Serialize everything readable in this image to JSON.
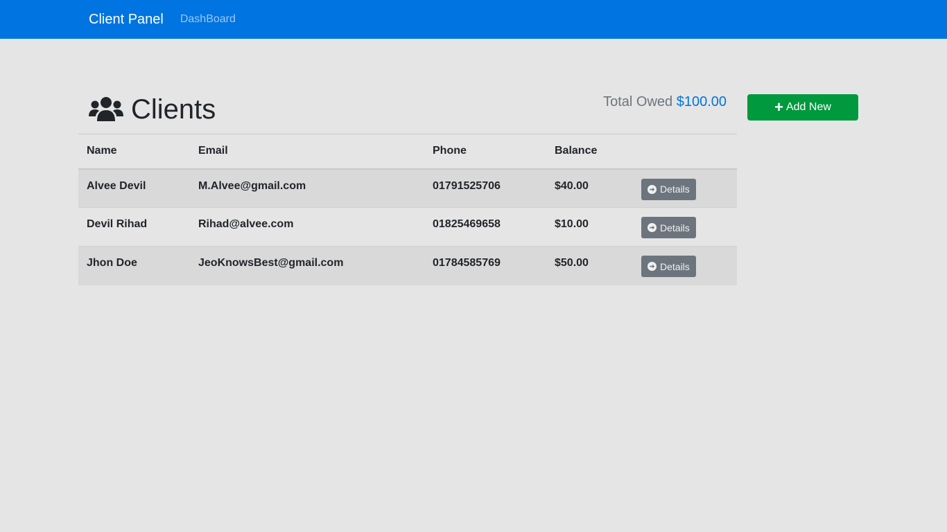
{
  "navbar": {
    "brand": "Client Panel",
    "dashboard_link": "DashBoard",
    "color": "#0074e0"
  },
  "header": {
    "title": "Clients",
    "icon": "users-icon",
    "total_label": "Total Owed",
    "total_amount": "$100.00"
  },
  "add_button": {
    "label": "Add New",
    "icon": "plus-icon",
    "color": "#00993d"
  },
  "table": {
    "columns": [
      "Name",
      "Email",
      "Phone",
      "Balance",
      ""
    ],
    "rows": [
      {
        "name": "Alvee Devil",
        "email": "M.Alvee@gmail.com",
        "phone": "01791525706",
        "balance": "$40.00",
        "action": "Details"
      },
      {
        "name": "Devil Rihad",
        "email": "Rihad@alvee.com",
        "phone": "01825469658",
        "balance": "$10.00",
        "action": "Details"
      },
      {
        "name": "Jhon Doe",
        "email": "JeoKnowsBest@gmail.com",
        "phone": "01784585769",
        "balance": "$50.00",
        "action": "Details"
      }
    ]
  }
}
